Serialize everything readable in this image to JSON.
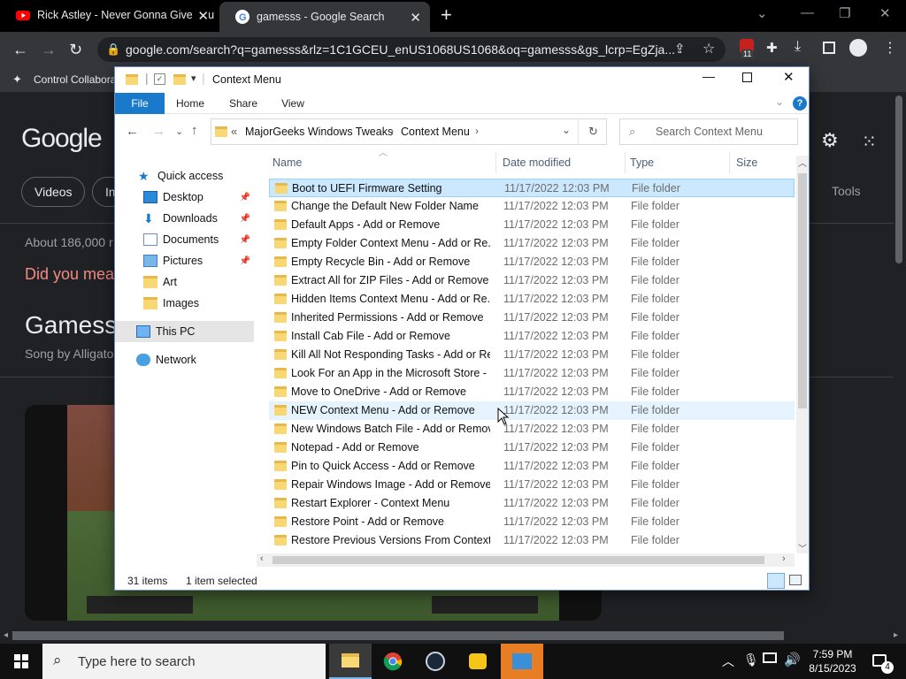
{
  "chrome": {
    "tabs": [
      {
        "title": "Rick Astley - Never Gonna Give You Up"
      },
      {
        "title": "gamesss - Google Search"
      }
    ],
    "url": "google.com/search?q=gamesss&rlz=1C1GCEU_enUS1068US1068&oq=gamesss&gs_lcrp=EgZja...",
    "bookmark": "Control Collabora",
    "extension_badge": "11"
  },
  "google": {
    "logo": "Google",
    "tabs": {
      "videos": "Videos",
      "partial": "Im",
      "tools": "Tools"
    },
    "about": "About 186,000 r",
    "did_you_mean": "Did you mea",
    "heading": "Gamess",
    "song": "Song by Alligato"
  },
  "explorer": {
    "title": "Context Menu",
    "ribbon": {
      "file": "File",
      "home": "Home",
      "share": "Share",
      "view": "View"
    },
    "breadcrumb": {
      "prefix": "«",
      "parent": "MajorGeeks Windows Tweaks",
      "current": "Context Menu"
    },
    "search_placeholder": "Search Context Menu",
    "columns": {
      "name": "Name",
      "date": "Date modified",
      "type": "Type",
      "size": "Size"
    },
    "nav": {
      "quick_access": "Quick access",
      "desktop": "Desktop",
      "downloads": "Downloads",
      "documents": "Documents",
      "pictures": "Pictures",
      "art": "Art",
      "images": "Images",
      "this_pc": "This PC",
      "network": "Network"
    },
    "rows": [
      {
        "name": "Boot to UEFI Firmware Setting",
        "date": "11/17/2022 12:03 PM",
        "type": "File folder"
      },
      {
        "name": "Change the Default New Folder Name",
        "date": "11/17/2022 12:03 PM",
        "type": "File folder"
      },
      {
        "name": "Default Apps - Add or Remove",
        "date": "11/17/2022 12:03 PM",
        "type": "File folder"
      },
      {
        "name": "Empty Folder Context Menu - Add or Re...",
        "date": "11/17/2022 12:03 PM",
        "type": "File folder"
      },
      {
        "name": "Empty Recycle Bin - Add or Remove",
        "date": "11/17/2022 12:03 PM",
        "type": "File folder"
      },
      {
        "name": "Extract All for ZIP Files - Add or Remove",
        "date": "11/17/2022 12:03 PM",
        "type": "File folder"
      },
      {
        "name": "Hidden Items Context Menu - Add or Re...",
        "date": "11/17/2022 12:03 PM",
        "type": "File folder"
      },
      {
        "name": "Inherited Permissions - Add or Remove",
        "date": "11/17/2022 12:03 PM",
        "type": "File folder"
      },
      {
        "name": "Install Cab File - Add or Remove",
        "date": "11/17/2022 12:03 PM",
        "type": "File folder"
      },
      {
        "name": "Kill All Not Responding Tasks - Add or Re...",
        "date": "11/17/2022 12:03 PM",
        "type": "File folder"
      },
      {
        "name": "Look For an App in the Microsoft Store - ...",
        "date": "11/17/2022 12:03 PM",
        "type": "File folder"
      },
      {
        "name": "Move to OneDrive - Add or Remove",
        "date": "11/17/2022 12:03 PM",
        "type": "File folder"
      },
      {
        "name": "NEW Context Menu - Add or Remove",
        "date": "11/17/2022 12:03 PM",
        "type": "File folder"
      },
      {
        "name": "New Windows Batch File - Add or Remove",
        "date": "11/17/2022 12:03 PM",
        "type": "File folder"
      },
      {
        "name": "Notepad - Add or Remove",
        "date": "11/17/2022 12:03 PM",
        "type": "File folder"
      },
      {
        "name": "Pin to Quick Access - Add or Remove",
        "date": "11/17/2022 12:03 PM",
        "type": "File folder"
      },
      {
        "name": "Repair Windows Image - Add or Remove",
        "date": "11/17/2022 12:03 PM",
        "type": "File folder"
      },
      {
        "name": "Restart Explorer - Context Menu",
        "date": "11/17/2022 12:03 PM",
        "type": "File folder"
      },
      {
        "name": "Restore Point - Add or Remove",
        "date": "11/17/2022 12:03 PM",
        "type": "File folder"
      },
      {
        "name": "Restore Previous Versions From Context ...",
        "date": "11/17/2022 12:03 PM",
        "type": "File folder"
      }
    ],
    "status": {
      "count": "31 items",
      "selected": "1 item selected"
    }
  },
  "taskbar": {
    "search_placeholder": "Type here to search",
    "time": "7:59 PM",
    "date": "8/15/2023",
    "notification_count": "4"
  }
}
